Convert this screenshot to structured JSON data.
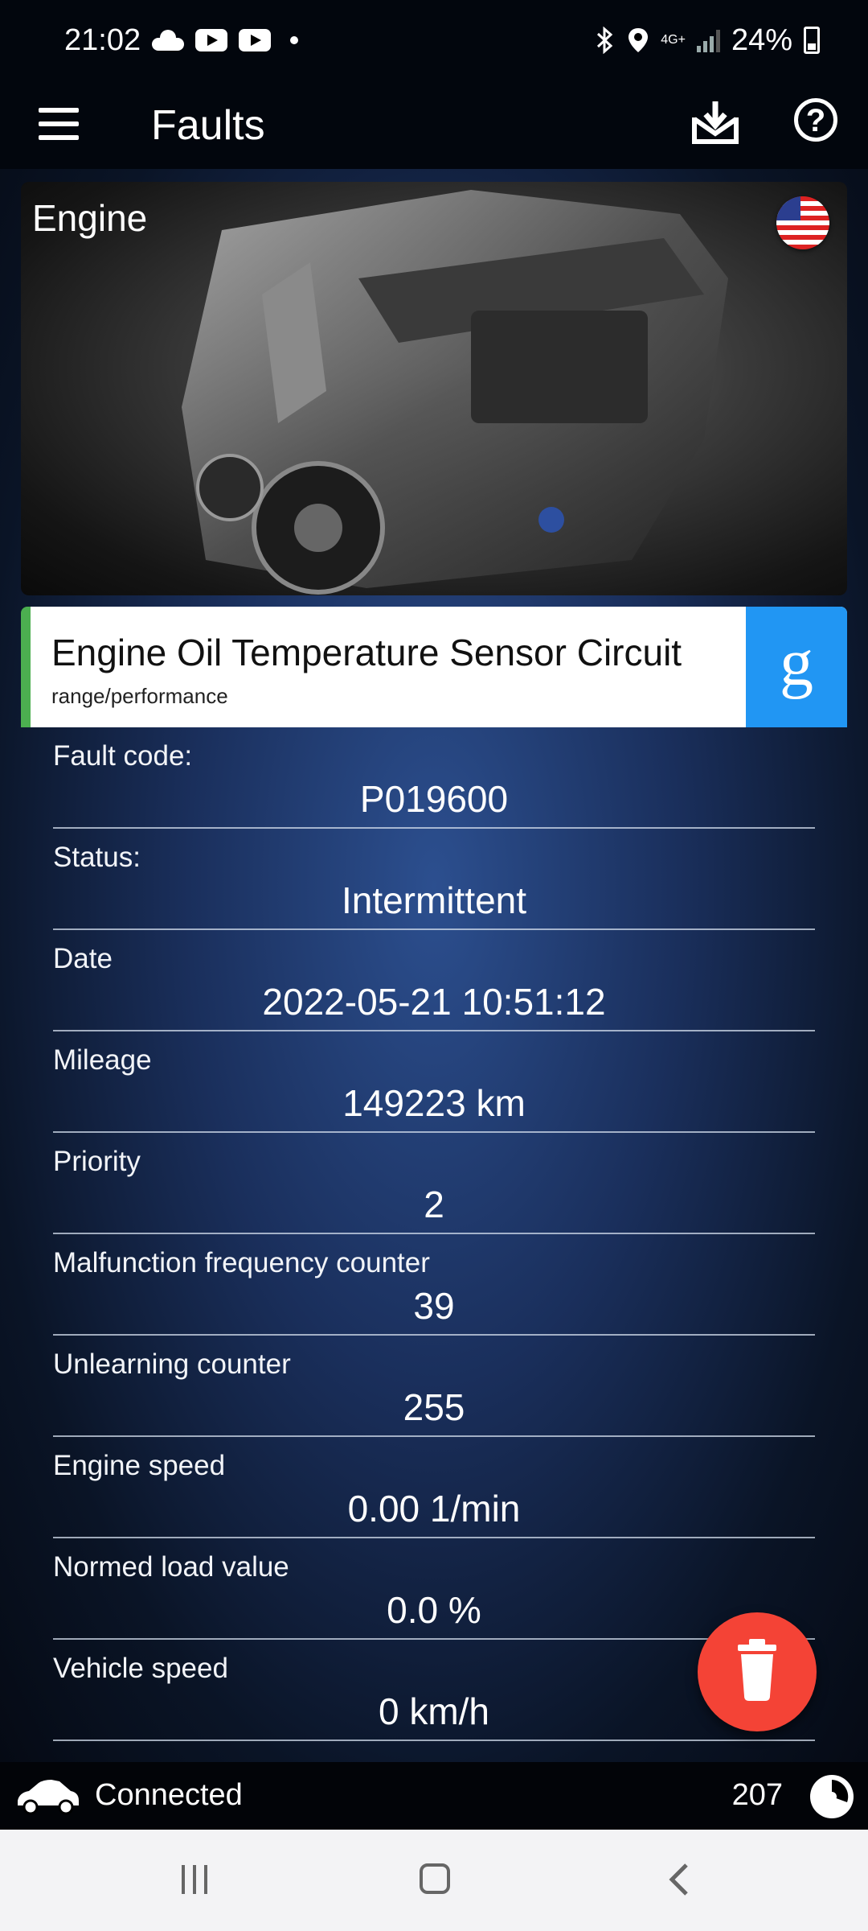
{
  "status_bar": {
    "time": "21:02",
    "network": "4G+",
    "battery": "24%"
  },
  "app_bar": {
    "title": "Faults"
  },
  "engine_card": {
    "title": "Engine",
    "flag": "us-flag-icon"
  },
  "fault": {
    "title": "Engine Oil Temperature Sensor Circuit",
    "subtitle": "range/performance",
    "google_label": "g",
    "accent_color": "#4caf50"
  },
  "details": [
    {
      "label": "Fault code:",
      "value": "P019600"
    },
    {
      "label": "Status:",
      "value": "Intermittent"
    },
    {
      "label": "Date",
      "value": "2022-05-21 10:51:12"
    },
    {
      "label": "Mileage",
      "value": "149223 km"
    },
    {
      "label": "Priority",
      "value": "2"
    },
    {
      "label": "Malfunction frequency counter",
      "value": "39"
    },
    {
      "label": "Unlearning counter",
      "value": "255"
    },
    {
      "label": "Engine speed",
      "value": "0.00 1/min"
    },
    {
      "label": "Normed load value",
      "value": "0.0 %"
    },
    {
      "label": "Vehicle speed",
      "value": "0 km/h"
    }
  ],
  "connection_bar": {
    "status": "Connected",
    "counter": "207"
  },
  "colors": {
    "fab": "#f44336",
    "google": "#2196f3"
  }
}
